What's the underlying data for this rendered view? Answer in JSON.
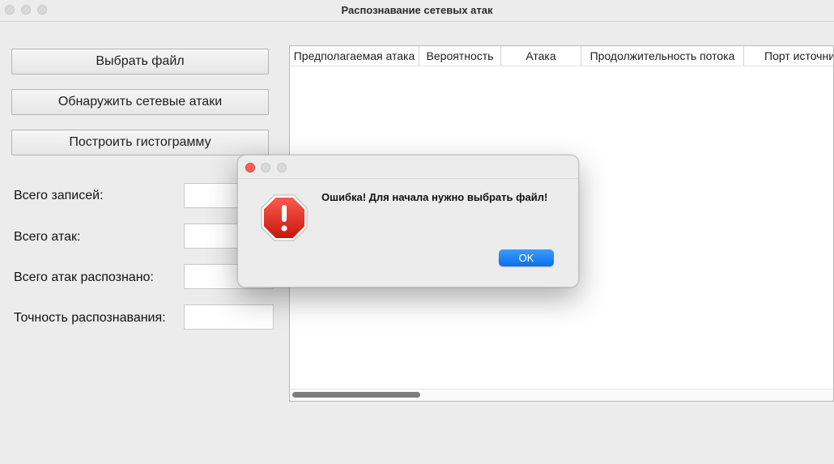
{
  "window": {
    "title": "Распознавание сетевых атак"
  },
  "buttons": {
    "select_file": "Выбрать файл",
    "detect_attacks": "Обнаружить сетевые атаки",
    "build_histogram": "Построить гистограмму"
  },
  "stats": [
    {
      "label": "Всего записей:",
      "value": ""
    },
    {
      "label": "Всего атак:",
      "value": ""
    },
    {
      "label": "Всего атак распознано:",
      "value": ""
    },
    {
      "label": "Точность распознавания:",
      "value": ""
    }
  ],
  "table": {
    "columns": [
      "Предполагаемая атака",
      "Вероятность",
      "Атака",
      "Продолжительность потока",
      "Порт источника"
    ],
    "rows": []
  },
  "dialog": {
    "message": "Ошибка! Для начала нужно выбрать файл!",
    "ok_label": "OK",
    "icon": "stop-error-icon"
  },
  "colors": {
    "accent": "#0a6fe8",
    "close": "#ff5f57",
    "error_icon": "#d32f2f"
  }
}
